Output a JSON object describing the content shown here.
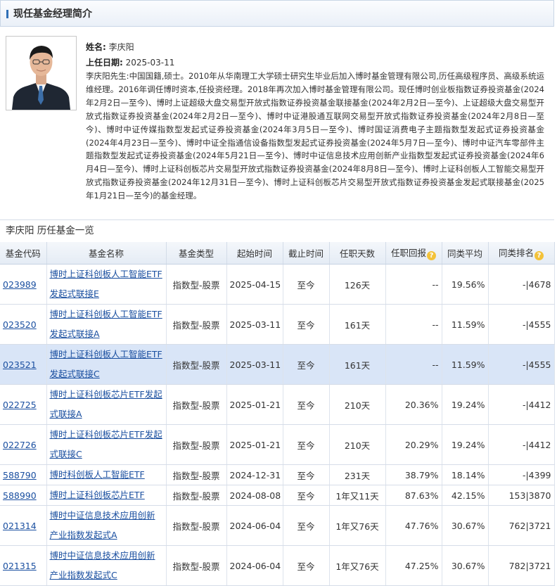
{
  "section_title": "现任基金经理简介",
  "manager": {
    "name_label": "姓名:",
    "name": "李庆阳",
    "date_label": "上任日期:",
    "date": "2025-03-11",
    "bio": "李庆阳先生:中国国籍,硕士。2010年从华南理工大学硕士研究生毕业后加入博时基金管理有限公司,历任高级程序员、高级系统运维经理。2016年调任博时资本,任投资经理。2018年再次加入博时基金管理有限公司。现任博时创业板指数证券投资基金(2024年2月2日—至今)、博时上证超级大盘交易型开放式指数证券投资基金联接基金(2024年2月2日—至今)、上证超级大盘交易型开放式指数证券投资基金(2024年2月2日—至今)、博时中证港股通互联网交易型开放式指数证券投资基金(2024年2月8日—至今)、博时中证传媒指数型发起式证券投资基金(2024年3月5日—至今)、博时国证消费电子主题指数型发起式证券投资基金(2024年4月23日—至今)、博时中证全指通信设备指数型发起式证券投资基金(2024年5月7日—至今)、博时中证汽车零部件主题指数型发起式证券投资基金(2024年5月21日—至今)、博时中证信息技术应用创新产业指数型发起式证券投资基金(2024年6月4日—至今)、博时上证科创板芯片交易型开放式指数证券投资基金(2024年8月8日—至今)、博时上证科创板人工智能交易型开放式指数证券投资基金(2024年12月31日—至今)、博时上证科创板芯片交易型开放式指数证券投资基金发起式联接基金(2025年1月21日—至今)的基金经理。"
  },
  "list_title": "李庆阳 历任基金一览",
  "table": {
    "headers": [
      "基金代码",
      "基金名称",
      "基金类型",
      "起始时间",
      "截止时间",
      "任职天数",
      "任职回报",
      "同类平均",
      "同类排名"
    ],
    "rows": [
      {
        "code": "023989",
        "name": "博时上证科创板人工智能ETF发起式联接E",
        "type": "指数型-股票",
        "start": "2025-04-15",
        "end": "至今",
        "days": "126天",
        "ret": "--",
        "avg": "19.56%",
        "rank": "-|4678"
      },
      {
        "code": "023520",
        "name": "博时上证科创板人工智能ETF发起式联接A",
        "type": "指数型-股票",
        "start": "2025-03-11",
        "end": "至今",
        "days": "161天",
        "ret": "--",
        "avg": "11.59%",
        "rank": "-|4555"
      },
      {
        "code": "023521",
        "name": "博时上证科创板人工智能ETF发起式联接C",
        "type": "指数型-股票",
        "start": "2025-03-11",
        "end": "至今",
        "days": "161天",
        "ret": "--",
        "avg": "11.59%",
        "rank": "-|4555"
      },
      {
        "code": "022725",
        "name": "博时上证科创板芯片ETF发起式联接A",
        "type": "指数型-股票",
        "start": "2025-01-21",
        "end": "至今",
        "days": "210天",
        "ret": "20.36%",
        "avg": "19.24%",
        "rank": "-|4412"
      },
      {
        "code": "022726",
        "name": "博时上证科创板芯片ETF发起式联接C",
        "type": "指数型-股票",
        "start": "2025-01-21",
        "end": "至今",
        "days": "210天",
        "ret": "20.29%",
        "avg": "19.24%",
        "rank": "-|4412"
      },
      {
        "code": "588790",
        "name": "博时科创板人工智能ETF",
        "type": "指数型-股票",
        "start": "2024-12-31",
        "end": "至今",
        "days": "231天",
        "ret": "38.79%",
        "avg": "18.14%",
        "rank": "-|4399"
      },
      {
        "code": "588990",
        "name": "博时上证科创板芯片ETF",
        "type": "指数型-股票",
        "start": "2024-08-08",
        "end": "至今",
        "days": "1年又11天",
        "ret": "87.63%",
        "avg": "42.15%",
        "rank": "153|3870"
      },
      {
        "code": "021314",
        "name": "博时中证信息技术应用创新产业指数发起式A",
        "type": "指数型-股票",
        "start": "2024-06-04",
        "end": "至今",
        "days": "1年又76天",
        "ret": "47.76%",
        "avg": "30.67%",
        "rank": "762|3721"
      },
      {
        "code": "021315",
        "name": "博时中证信息技术应用创新产业指数发起式C",
        "type": "指数型-股票",
        "start": "2024-06-04",
        "end": "至今",
        "days": "1年又76天",
        "ret": "47.25%",
        "avg": "30.67%",
        "rank": "782|3721"
      }
    ]
  },
  "colors": {
    "link": "#1a4fa0",
    "positive": "#e0232b",
    "selected_row": "#d9e5f7",
    "help_icon": "#f3c23a"
  },
  "icons": [
    "help-icon"
  ]
}
